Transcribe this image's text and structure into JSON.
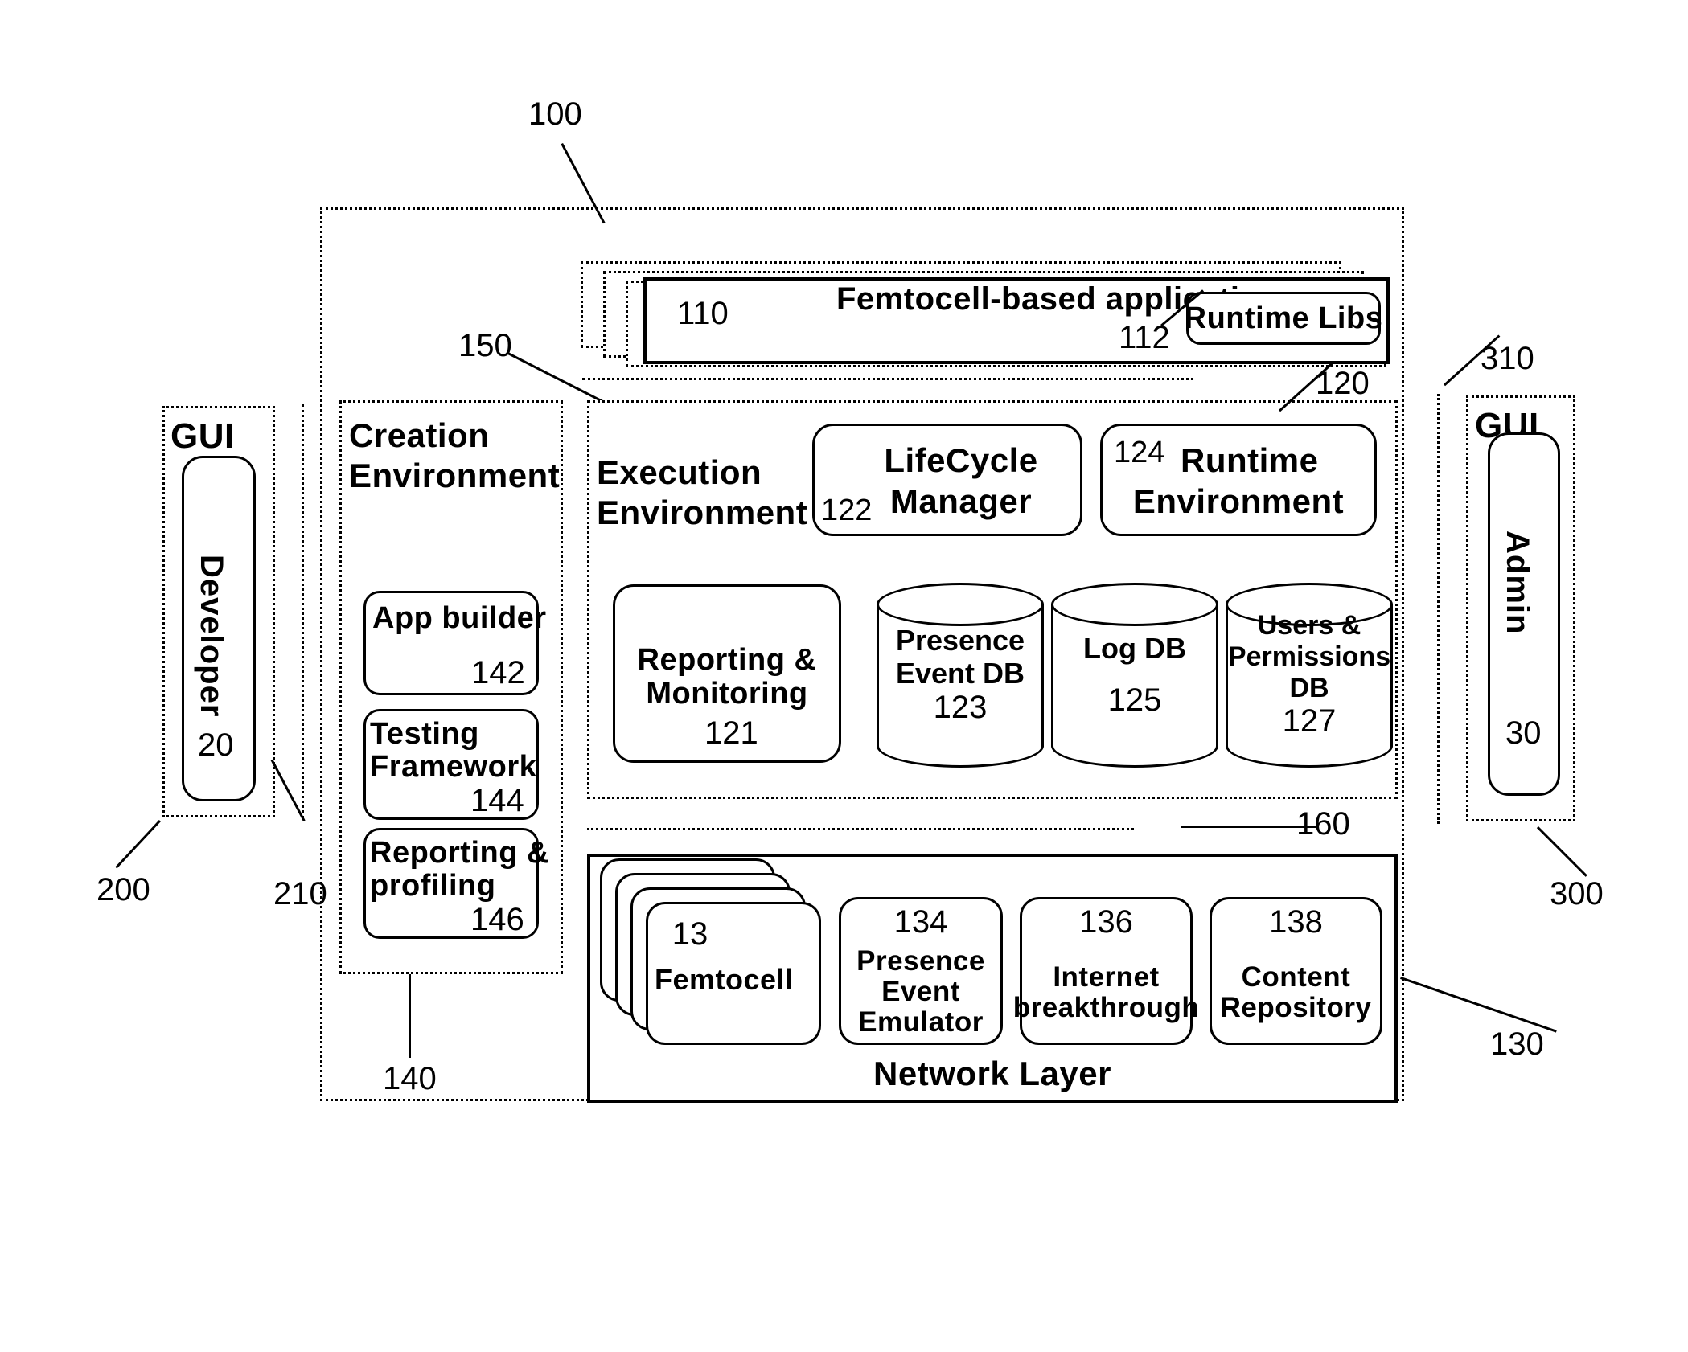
{
  "figure": {
    "root_ref": "100",
    "refs": {
      "platform": "100",
      "applications": "110",
      "runtime_libs": "112",
      "execution_environment": "120",
      "reporting_monitoring": "121",
      "lifecycle_manager": "122",
      "presence_event_db": "123",
      "runtime_environment": "124",
      "log_db": "125",
      "users_permissions_db": "127",
      "network_layer": "130",
      "femtocell": "13",
      "presence_event_emulator": "134",
      "internet_breakthrough": "136",
      "content_repository": "138",
      "creation_environment": "140",
      "app_builder": "142",
      "testing_framework": "144",
      "reporting_profiling": "146",
      "app_interface_line": "150",
      "network_interface_line": "160",
      "developer_terminal": "200",
      "developer_link": "210",
      "admin_terminal": "300",
      "admin_link": "310",
      "developer": "20",
      "admin": "30"
    }
  },
  "applications": {
    "label": "Femtocell-based applications",
    "ref": "110",
    "runtime_libs": {
      "label": "Runtime Libs",
      "ref": "112"
    }
  },
  "creation_environment": {
    "title_line1": "Creation",
    "title_line2": "Environment",
    "ref": "140",
    "items": [
      {
        "label": "App builder",
        "ref": "142"
      },
      {
        "label_line1": "Testing",
        "label_line2": "Framework",
        "ref": "144"
      },
      {
        "label_line1": "Reporting &",
        "label_line2": "profiling",
        "ref": "146"
      }
    ]
  },
  "execution_environment": {
    "title_line1": "Execution",
    "title_line2": "Environment",
    "ref": "120",
    "lifecycle_manager": {
      "line1": "LifeCycle",
      "line2": "Manager",
      "ref": "122"
    },
    "runtime_environment": {
      "line1": "Runtime",
      "line2": "Environment",
      "ref": "124"
    },
    "reporting_monitoring": {
      "line1": "Reporting &",
      "line2": "Monitoring",
      "ref": "121"
    },
    "databases": [
      {
        "line1": "Presence",
        "line2": "Event DB",
        "ref": "123"
      },
      {
        "line1": "Log DB",
        "line2": "",
        "ref": "125"
      },
      {
        "line1": "Users &",
        "line2": "Permissions",
        "line3": "DB",
        "ref": "127"
      }
    ]
  },
  "network_layer": {
    "title": "Network Layer",
    "ref": "130",
    "femtocell": {
      "label": "Femtocell",
      "ref": "13"
    },
    "items": [
      {
        "line1": "Presence",
        "line2": "Event",
        "line3": "Emulator",
        "ref": "134"
      },
      {
        "line1": "Internet",
        "line2": "breakthrough",
        "ref": "136"
      },
      {
        "line1": "Content",
        "line2": "Repository",
        "ref": "138"
      }
    ]
  },
  "developer_terminal": {
    "gui_label": "GUI",
    "actor": "Developer",
    "actor_ref": "20",
    "ref": "200",
    "link_ref": "210"
  },
  "admin_terminal": {
    "gui_label": "GUI",
    "actor": "Admin",
    "actor_ref": "30",
    "ref": "300",
    "link_ref": "310"
  },
  "interfaces": {
    "app_interface_ref": "150",
    "network_interface_ref": "160"
  }
}
